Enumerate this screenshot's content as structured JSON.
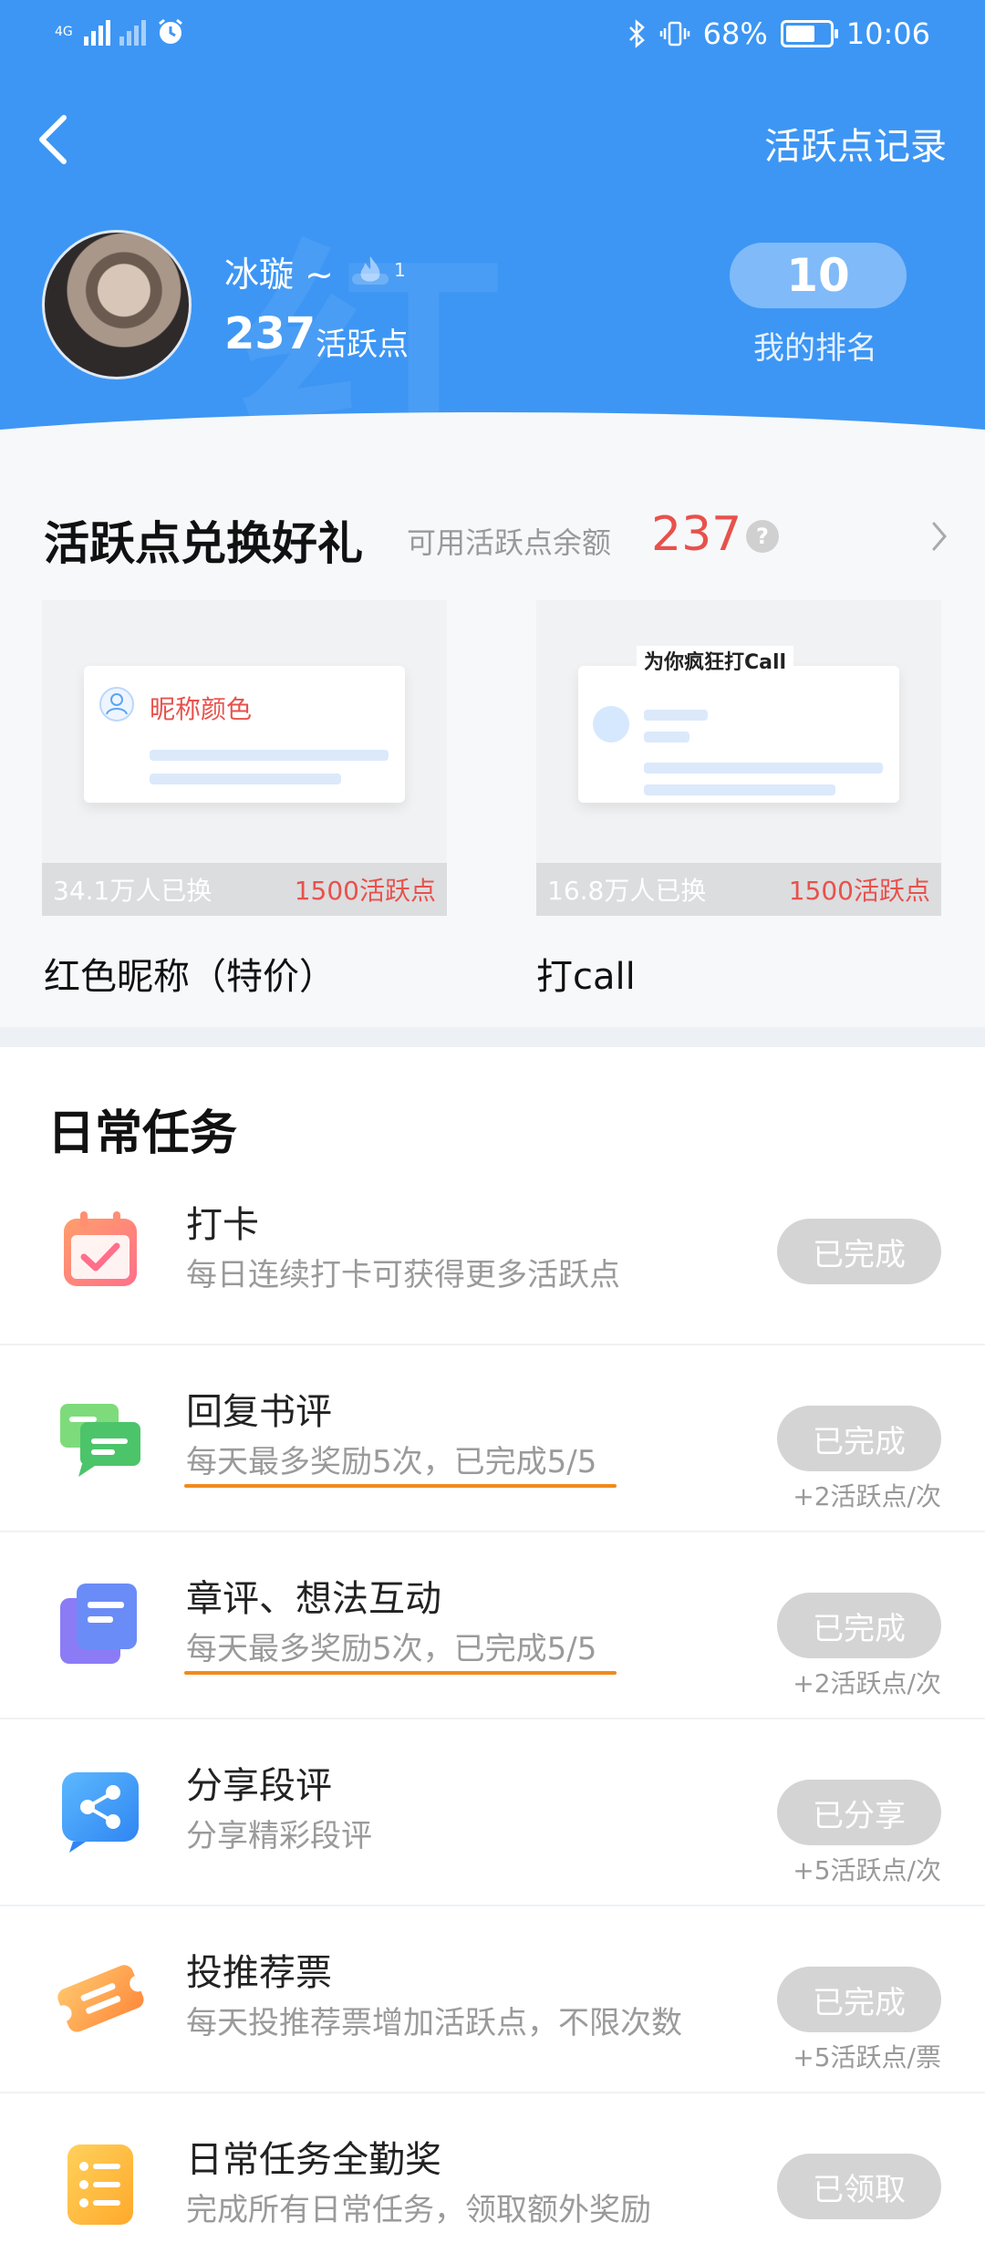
{
  "status_bar": {
    "net_label": "4G",
    "battery_percent": "68%",
    "time": "10:06",
    "battery_level": 0.68
  },
  "header": {
    "record_link": "活跃点记录",
    "user": {
      "name": "冰璇 ~",
      "level": "1",
      "points": "237",
      "points_unit": "活跃点"
    },
    "rank": {
      "value": "10",
      "label": "我的排名"
    },
    "accent_color": "#3d96f4"
  },
  "exchange": {
    "title": "活跃点兑换好礼",
    "available_label": "可用活跃点余额",
    "balance": "237",
    "help_glyph": "?",
    "gifts": [
      {
        "preview_text": "昵称颜色",
        "exchanged": "34.1万人已换",
        "cost": "1500活跃点",
        "name": "红色昵称（特价）"
      },
      {
        "preview_text": "为你疯狂打Call",
        "exchanged": "16.8万人已换",
        "cost": "1500活跃点",
        "name": "打call"
      }
    ]
  },
  "daily_tasks": {
    "title": "日常任务",
    "items": [
      {
        "icon": "calendar-check-icon",
        "name": "打卡",
        "desc": "每日连续打卡可获得更多活跃点",
        "button": "已完成",
        "reward": ""
      },
      {
        "icon": "chat-bubbles-icon",
        "name": "回复书评",
        "desc": "每天最多奖励5次，已完成5/5",
        "button": "已完成",
        "reward": "+2活跃点/次"
      },
      {
        "icon": "comment-cards-icon",
        "name": "章评、想法互动",
        "desc": "每天最多奖励5次，已完成5/5",
        "button": "已完成",
        "reward": "+2活跃点/次"
      },
      {
        "icon": "share-icon",
        "name": "分享段评",
        "desc": "分享精彩段评",
        "button": "已分享",
        "reward": "+5活跃点/次"
      },
      {
        "icon": "ticket-icon",
        "name": "投推荐票",
        "desc": "每天投推荐票增加活跃点，不限次数",
        "button": "已完成",
        "reward": "+5活跃点/票"
      },
      {
        "icon": "list-icon",
        "name": "日常任务全勤奖",
        "desc": "完成所有日常任务，领取额外奖励",
        "button": "已领取",
        "reward": ""
      }
    ]
  }
}
